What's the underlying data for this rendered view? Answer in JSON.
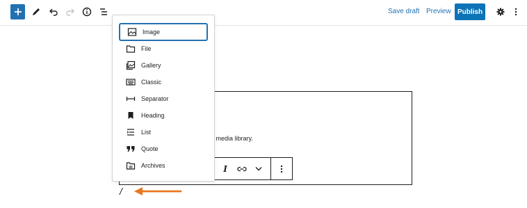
{
  "toolbar": {
    "add_icon": "plus-icon",
    "tools_icon": "pencil-icon",
    "undo_icon": "undo-icon",
    "redo_icon": "redo-icon",
    "details_icon": "info-icon",
    "outline_icon": "list-view-icon",
    "save_draft_label": "Save draft",
    "preview_label": "Preview",
    "publish_label": "Publish",
    "settings_icon": "gear-icon",
    "options_icon": "more-vertical-icon"
  },
  "inserter": {
    "items": [
      {
        "label": "Image",
        "icon": "image-icon",
        "active": true
      },
      {
        "label": "File",
        "icon": "folder-icon"
      },
      {
        "label": "Gallery",
        "icon": "gallery-icon"
      },
      {
        "label": "Classic",
        "icon": "keyboard-icon"
      },
      {
        "label": "Separator",
        "icon": "separator-icon"
      },
      {
        "label": "Heading",
        "icon": "bookmark-icon"
      },
      {
        "label": "List",
        "icon": "list-icon"
      },
      {
        "label": "Quote",
        "icon": "quote-icon"
      },
      {
        "label": "Archives",
        "icon": "archive-icon"
      }
    ]
  },
  "block": {
    "partial_text": "ur media library."
  },
  "block_toolbar": {
    "italic_label": "I",
    "link_icon": "link-icon",
    "more_icon": "chevron-down-icon",
    "options_icon": "more-vertical-icon"
  },
  "editor": {
    "slash_text": "/"
  },
  "colors": {
    "accent": "#2271b1",
    "publish": "#0b73b6",
    "arrow": "#e87722"
  }
}
